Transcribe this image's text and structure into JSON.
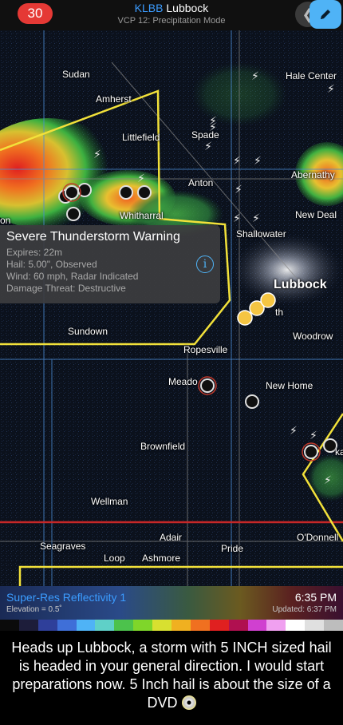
{
  "header": {
    "badge_count": "30",
    "station": "KLBB",
    "location": "Lubbock",
    "subtitle": "VCP 12: Precipitation Mode",
    "back_icon": "chevron-left-icon",
    "edit_icon": "pencil-icon"
  },
  "map": {
    "towns": {
      "sudan": "Sudan",
      "hale_center": "Hale Center",
      "amherst": "Amherst",
      "littlefield": "Littlefield",
      "spade": "Spade",
      "anton": "Anton",
      "abernathy": "Abernathy",
      "new_deal": "New Deal",
      "whitharral": "Whitharral",
      "left_edge": "on",
      "shallowater": "Shallowater",
      "lubbock": "Lubbock",
      "wolfforth_partial": "th",
      "woodrow": "Woodrow",
      "sundown": "Sundown",
      "ropesville": "Ropesville",
      "meadow": "Meado",
      "new_home": "New Home",
      "brownfield": "Brownfield",
      "right_edge": "ka",
      "wellman": "Wellman",
      "adair": "Adair",
      "odonnell": "O'Donnell",
      "seagraves": "Seagraves",
      "pride": "Pride",
      "loop": "Loop",
      "ashmore": "Ashmore"
    }
  },
  "warning": {
    "title": "Severe Thunderstorm Warning",
    "expires": "Expires: 22m",
    "hail": "Hail: 5.00\", Observed",
    "wind": "Wind: 60 mph, Radar Indicated",
    "damage": "Damage Threat: Destructive",
    "info_icon": "info-icon"
  },
  "status": {
    "product": "Super-Res Reflectivity 1",
    "elevation": "Elevation = 0.5˚",
    "time": "6:35 PM",
    "updated": "Updated: 6:37 PM"
  },
  "scale_colors": [
    "#0b0b0b",
    "#1d1d3a",
    "#2f3f9a",
    "#3f6fd8",
    "#4fb3f6",
    "#5fd0c8",
    "#4cc24c",
    "#7fd62a",
    "#d8e030",
    "#f0b020",
    "#f07020",
    "#e02020",
    "#b01050",
    "#d040d0",
    "#f0a0f0",
    "#ffffff",
    "#e0e0e0",
    "#bdbdbd"
  ],
  "caption": {
    "text": "Heads up Lubbock, a storm with 5 INCH sized hail is headed in your general direction. I would start preparations now. 5 Inch hail is about the size of a DVD",
    "icon": "dvd-icon"
  },
  "colors": {
    "accent": "#3b9cff",
    "badge": "#e53935",
    "warning_border": "#f2e13a",
    "county_line": "#4b8bd6",
    "state_line": "#c62828"
  }
}
